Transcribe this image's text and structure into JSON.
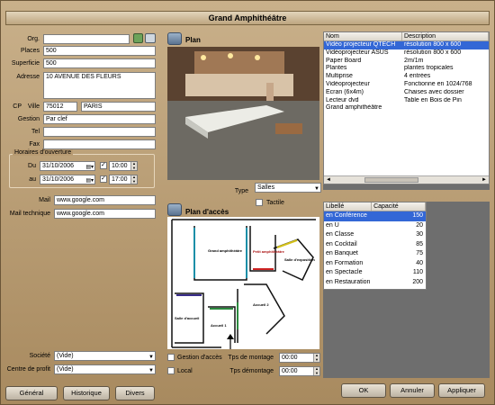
{
  "window": {
    "title": "Grand Amphithéâtre"
  },
  "form": {
    "org_label": "Org.",
    "places_label": "Places",
    "places_value": "500",
    "superficie_label": "Superficie",
    "superficie_value": "500",
    "adresse_label": "Adresse",
    "adresse_value": "10 AVENUE DES FLEURS",
    "cp_label": "CP",
    "ville_label": "Ville",
    "cp_value": "75012",
    "ville_value": "PARIS",
    "gestion_label": "Gestion",
    "gestion_value": "Par clef",
    "tel_label": "Tel",
    "fax_label": "Fax",
    "horaires_title": "Horaires d'ouverture",
    "du_label": "Du",
    "du_date": "31/10/2006",
    "du_time": "10:00",
    "au_label": "au",
    "au_date": "31/10/2006",
    "au_time": "17:00",
    "mail_label": "Mail",
    "mail_value": "www.google.com",
    "mail_tech_label": "Mail technique",
    "mail_tech_value": "www.google.com",
    "societe_label": "Société",
    "societe_value": "(Vide)",
    "centre_label": "Centre de profit",
    "centre_value": "(Vide)"
  },
  "plan": {
    "title": "Plan",
    "type_label": "Type",
    "type_value": "Salles",
    "tactile_label": "Tactile"
  },
  "plan_acces": {
    "title": "Plan d'accès",
    "map_labels": [
      "Grand amphithéâtre",
      "Petit amphithéâtre",
      "Salle d'exposition",
      "Salle de conférence",
      "Salle d'accueil",
      "Accueil 1",
      "Accueil 2"
    ],
    "gestion_acces_label": "Gestion d'accès",
    "local_label": "Local",
    "montage_label": "Tps de montage",
    "montage_value": "00:00",
    "demontage_label": "Tps démontage",
    "demontage_value": "00:00"
  },
  "equipment": {
    "columns": [
      "Nom",
      "Description"
    ],
    "rows": [
      [
        "Vidéo projecteur QTECH",
        "résolution 800 x 600"
      ],
      [
        "Vidéoprojecteur ASUS",
        "résolution 800 x 600"
      ],
      [
        "Paper Board",
        "2m/1m"
      ],
      [
        "Plantes",
        "plantes tropicales"
      ],
      [
        "Multiprise",
        "4 entrées"
      ],
      [
        "Vidéoprojecteur",
        "Fonctionne en 1024/768"
      ],
      [
        "Ecran (6x4m)",
        "Chaises avec dossier"
      ],
      [
        "Lecteur dvd",
        "Table en Bois de Pin"
      ],
      [
        "Grand amphithéâtre",
        ""
      ]
    ],
    "scroll_left": "◄",
    "scroll_right": "►"
  },
  "capacity": {
    "columns": [
      "Libellé",
      "Capacité"
    ],
    "rows": [
      [
        "en Conférence",
        "150"
      ],
      [
        "en U",
        "20"
      ],
      [
        "en Classe",
        "30"
      ],
      [
        "en Cocktail",
        "85"
      ],
      [
        "en Banquet",
        "75"
      ],
      [
        "en Formation",
        "40"
      ],
      [
        "en Spectacle",
        "110"
      ],
      [
        "en Restauration",
        "200"
      ]
    ]
  },
  "buttons": {
    "general": "Général",
    "historique": "Historique",
    "divers": "Divers",
    "ok": "OK",
    "annuler": "Annuler",
    "appliquer": "Appliquer"
  }
}
